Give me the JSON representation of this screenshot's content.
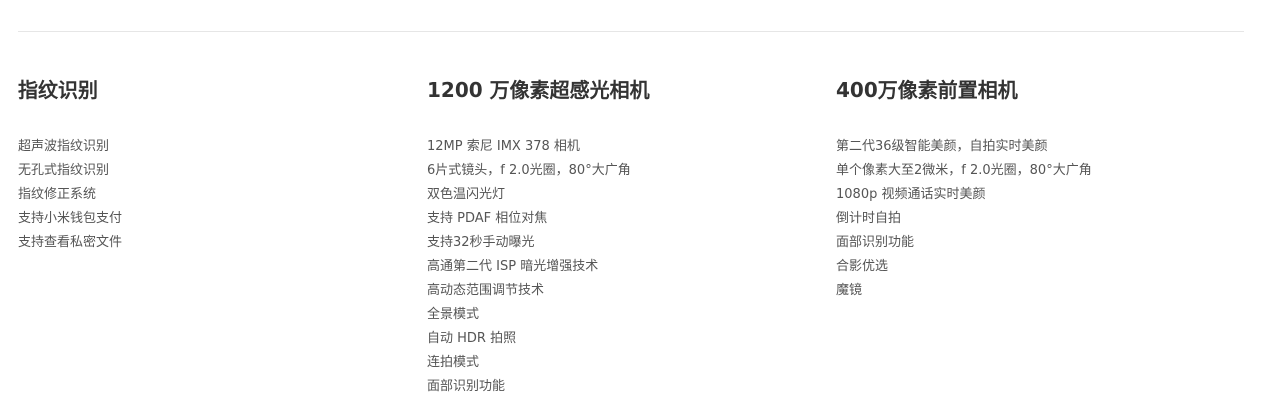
{
  "columns": [
    {
      "title": "指纹识别",
      "items": [
        "超声波指纹识别",
        "无孔式指纹识别",
        "指纹修正系统",
        "支持小米钱包支付",
        "支持查看私密文件"
      ]
    },
    {
      "title": "1200 万像素超感光相机",
      "items": [
        "12MP 索尼 IMX 378 相机",
        "6片式镜头，f 2.0光圈，80°大广角",
        "双色温闪光灯",
        "支持 PDAF 相位对焦",
        "支持32秒手动曝光",
        "高通第二代 ISP 暗光增强技术",
        "高动态范围调节技术",
        "全景模式",
        "自动 HDR 拍照",
        "连拍模式",
        "面部识别功能"
      ]
    },
    {
      "title": "400万像素前置相机",
      "items": [
        "第二代36级智能美颜，自拍实时美颜",
        "单个像素大至2微米，f 2.0光圈，80°大广角",
        "1080p 视频通话实时美颜",
        "倒计时自拍",
        "面部识别功能",
        "合影优选",
        "魔镜"
      ]
    }
  ]
}
